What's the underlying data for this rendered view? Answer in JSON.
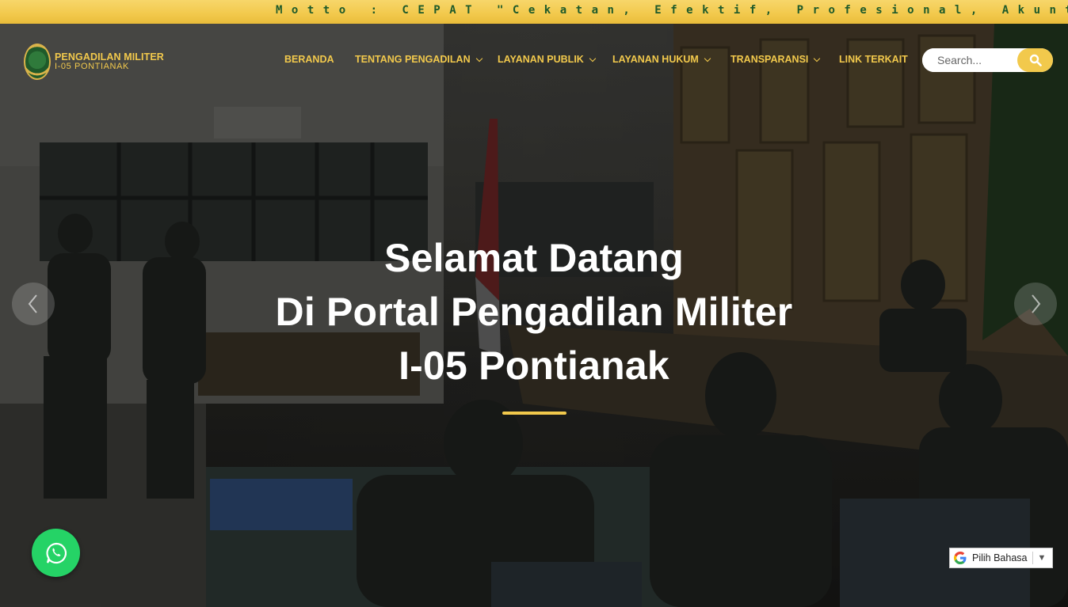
{
  "ticker": {
    "motto": "Motto : CEPAT \"Cekatan, Efektif, Profesional, Akunta"
  },
  "logo": {
    "line1": "PENGADILAN MILITER",
    "line2": "I-05 PONTIANAK"
  },
  "nav": {
    "items": [
      {
        "label": "BERANDA",
        "dropdown": false
      },
      {
        "label": "TENTANG PENGADILAN",
        "dropdown": true
      },
      {
        "label": "LAYANAN PUBLIK",
        "dropdown": true
      },
      {
        "label": "LAYANAN HUKUM",
        "dropdown": true
      },
      {
        "label": "TRANSPARANSI",
        "dropdown": true
      },
      {
        "label": "LINK TERKAIT",
        "dropdown": false
      }
    ]
  },
  "search": {
    "placeholder": "Search..."
  },
  "hero": {
    "line1": "Selamat Datang",
    "line2": "Di Portal Pengadilan Militer",
    "line3": "I-05 Pontianak"
  },
  "translate": {
    "label": "Pilih Bahasa"
  },
  "colors": {
    "accent": "#f2c94c",
    "whatsapp": "#25d366",
    "motto_text": "#1e5a2a"
  },
  "icons": {
    "search": "search-icon",
    "prev": "chevron-left-icon",
    "next": "chevron-right-icon",
    "whatsapp": "whatsapp-icon",
    "google": "google-g-icon"
  }
}
